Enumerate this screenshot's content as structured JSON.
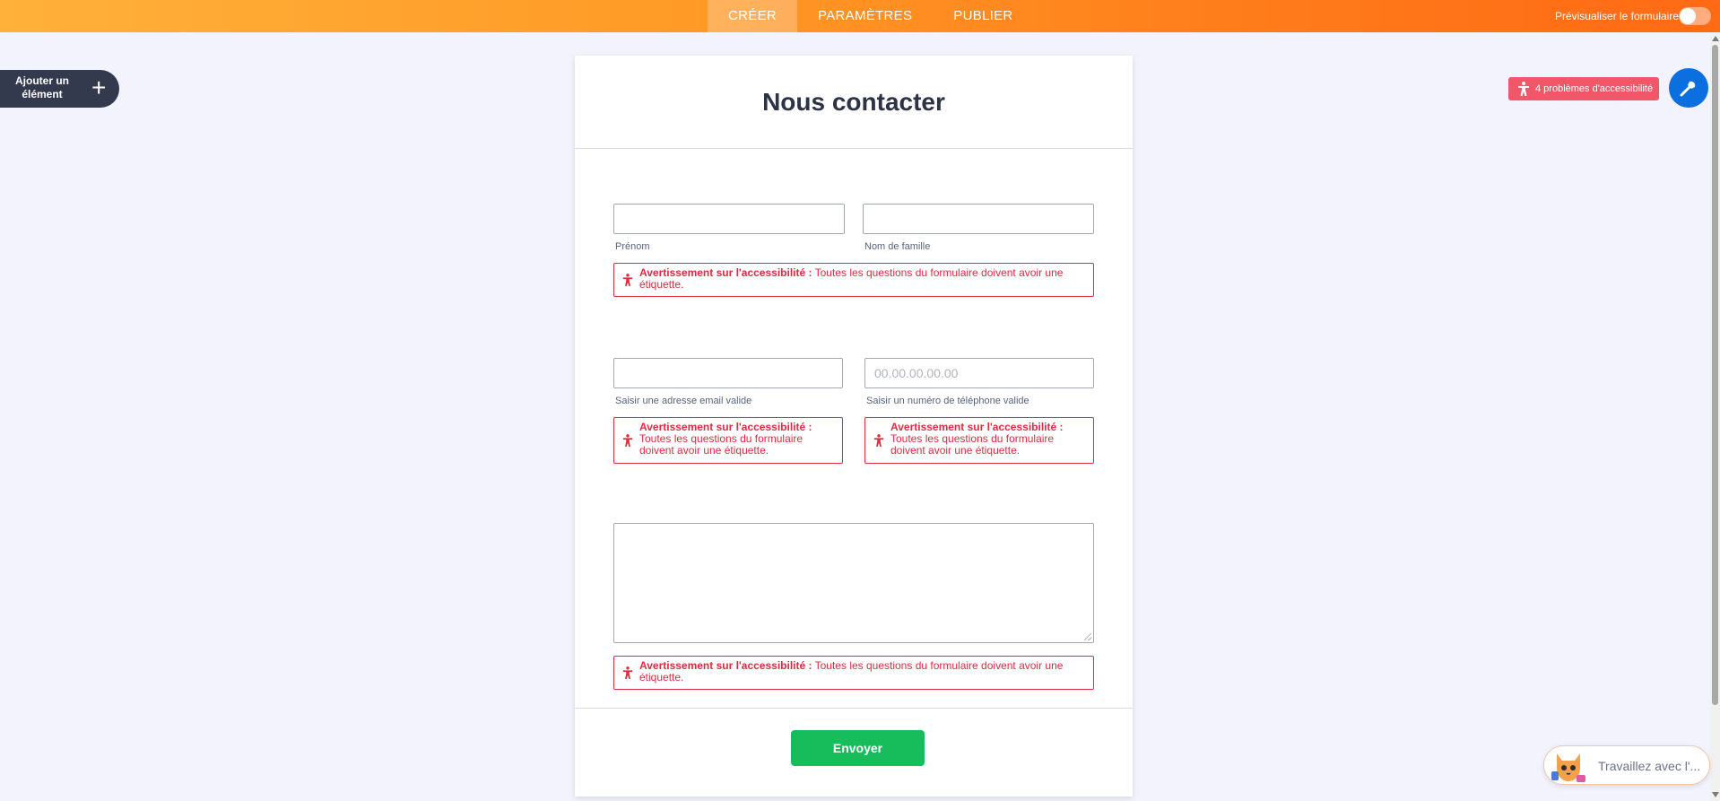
{
  "topbar": {
    "tabs": [
      {
        "label": "CRÉER",
        "active": true
      },
      {
        "label": "PARAMÈTRES",
        "active": false
      },
      {
        "label": "PUBLIER",
        "active": false
      }
    ],
    "preview_label": "Prévisualiser le formulaire",
    "preview_toggle_on": false
  },
  "sidebar": {
    "add_element_label": "Ajouter un élément",
    "add_icon": "plus-icon"
  },
  "accessibility": {
    "badge_label": "4 problèmes d'accessibilité",
    "badge_color": "#f25769",
    "wand_color": "#0b6fe0"
  },
  "form": {
    "title": "Nous contacter",
    "fields": {
      "first_name": {
        "value": "",
        "sublabel": "Prénom"
      },
      "last_name": {
        "value": "",
        "sublabel": "Nom de famille"
      },
      "email": {
        "value": "",
        "sublabel": "Saisir une adresse email valide"
      },
      "phone": {
        "placeholder": "00.00.00.00.00",
        "sublabel": "Saisir un numéro de téléphone valide"
      },
      "message": {
        "value": ""
      }
    },
    "warning": {
      "title": "Avertissement sur l'accessibilité :",
      "text": "Toutes les questions du formulaire doivent avoir une étiquette."
    },
    "submit_label": "Envoyer",
    "submit_color": "#18bd5b"
  },
  "assistant": {
    "label": "Travaillez avec l'..."
  },
  "colors": {
    "warning": "#de2b40",
    "topbar_start": "#ffb13a",
    "topbar_end": "#ff6a14"
  }
}
